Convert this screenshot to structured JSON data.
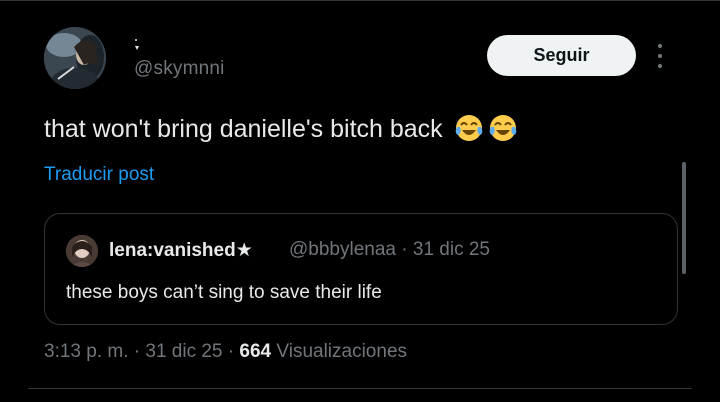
{
  "author": {
    "name_icon": "sparkle-icon",
    "handle": "@skymnni"
  },
  "actions": {
    "follow_label": "Seguir",
    "more_icon": "more-vertical-icon"
  },
  "tweet": {
    "text": "that won't bring danielle's bitch back",
    "emojis": [
      "face-with-tears-of-joy-icon",
      "face-with-tears-of-joy-icon"
    ],
    "translate_label": "Traducir post"
  },
  "quote": {
    "name": "lena:vanished★",
    "handle": "@bbbylenaa",
    "separator": " · ",
    "date": "31 dic 25",
    "text": "these boys can’t sing to save their life"
  },
  "footer": {
    "time": "3:13 p. m.",
    "separator1": " · ",
    "date": "31 dic 25",
    "separator2": " · ",
    "views_count": "664",
    "views_label": "Visualizaciones"
  },
  "colors": {
    "background": "#000000",
    "text_primary": "#e7e9ea",
    "text_secondary": "#71767b",
    "link": "#1d9bf0",
    "border": "#2f3336",
    "button_bg": "#eff3f4"
  }
}
